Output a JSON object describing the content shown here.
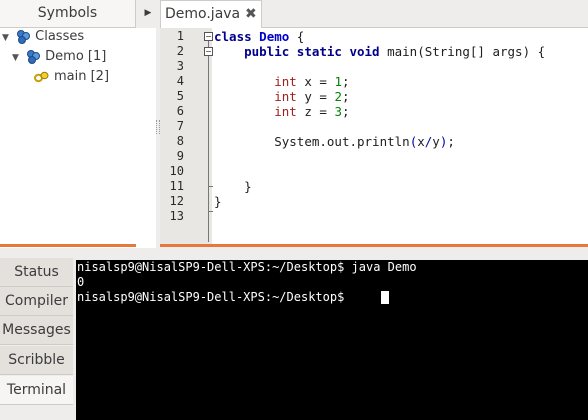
{
  "symbols": {
    "tab_label": "Symbols",
    "tree": [
      {
        "label": "Classes",
        "icon": "classes-icon"
      },
      {
        "label": "Demo [1]",
        "icon": "class-icon"
      },
      {
        "label": "main [2]",
        "icon": "method-icon"
      }
    ]
  },
  "editor": {
    "tab_label": "Demo.java",
    "line_numbers": [
      "1",
      "2",
      "3",
      "4",
      "5",
      "6",
      "7",
      "8",
      "9",
      "10",
      "11",
      "12",
      "13"
    ],
    "code": {
      "l1_kw": "class",
      "l1_name": "Demo",
      "l1_rest": " {",
      "l2_kw": "public static void",
      "l2_rest": " main(String[] args) {",
      "l4_type": "int",
      "l4_mid": " x = ",
      "l4_num": "1",
      "l4_end": ";",
      "l5_type": "int",
      "l5_mid": " y = ",
      "l5_num": "2",
      "l5_end": ";",
      "l6_type": "int",
      "l6_mid": " z = ",
      "l6_num": "3",
      "l6_end": ";",
      "l8_a": "System.out.println",
      "l8_b": "(",
      "l8_c": "x",
      "l8_d": "/",
      "l8_e": "y",
      "l8_f": ")",
      "l8_g": ";",
      "l11": "}",
      "l12": "}"
    }
  },
  "bottom": {
    "tabs": [
      "Status",
      "Compiler",
      "Messages",
      "Scribble",
      "Terminal"
    ],
    "active_tab": "Terminal",
    "terminal_lines": [
      "nisalsp9@NisalSP9-Dell-XPS:~/Desktop$ java Demo",
      "0",
      "nisalsp9@NisalSP9-Dell-XPS:~/Desktop$ "
    ]
  },
  "colors": {
    "accent_splitter": "#e6783e",
    "terminal_bg": "#000000",
    "keyword": "#00008b",
    "type": "#a02020",
    "number": "#008800"
  }
}
